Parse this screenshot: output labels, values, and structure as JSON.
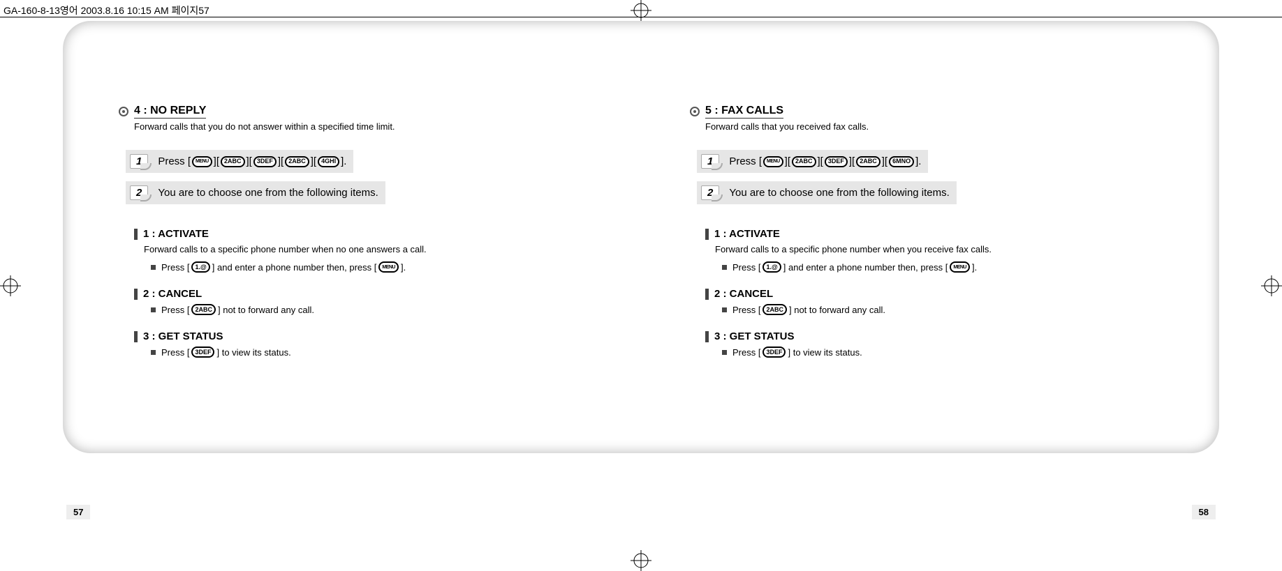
{
  "print_header": "GA-160-8-13영어  2003.8.16 10:15 AM  페이지57",
  "left": {
    "title": "4 : NO REPLY",
    "desc": "Forward calls that you do not answer within a specified time limit.",
    "step1_prefix": "Press [",
    "step1_keys": [
      "MENU",
      "2ABC",
      "3DEF",
      "2ABC",
      "4GHI"
    ],
    "step1_suffix": "].",
    "step2": "You are to choose one from the following items.",
    "sub": [
      {
        "heading": "1 : ACTIVATE",
        "desc": "Forward calls to a specific phone number when no one answers a call.",
        "action_pre": "Press [",
        "action_key1": "1.@",
        "action_mid": "] and enter a phone number then, press [",
        "action_key2": "MENU",
        "action_post": "]."
      },
      {
        "heading": "2 : CANCEL",
        "action_pre": "Press [",
        "action_key1": "2ABC",
        "action_mid": "] not to forward any call.",
        "action_key2": "",
        "action_post": ""
      },
      {
        "heading": "3 : GET STATUS",
        "action_pre": "Press [",
        "action_key1": "3DEF",
        "action_mid": "] to view its status.",
        "action_key2": "",
        "action_post": ""
      }
    ],
    "page_number": "57"
  },
  "right": {
    "title": "5 : FAX CALLS",
    "desc": "Forward calls that you received fax calls.",
    "step1_prefix": "Press [",
    "step1_keys": [
      "MENU",
      "2ABC",
      "3DEF",
      "2ABC",
      "6MNO"
    ],
    "step1_suffix": "].",
    "step2": "You are to choose one from the following items.",
    "sub": [
      {
        "heading": "1 : ACTIVATE",
        "desc": "Forward calls to a specific phone number when you receive fax calls.",
        "action_pre": "Press [",
        "action_key1": "1.@",
        "action_mid": "] and enter a phone number then, press [",
        "action_key2": "MENU",
        "action_post": "]."
      },
      {
        "heading": "2 : CANCEL",
        "action_pre": "Press [",
        "action_key1": "2ABC",
        "action_mid": "] not to forward any call.",
        "action_key2": "",
        "action_post": ""
      },
      {
        "heading": "3 : GET STATUS",
        "action_pre": "Press [",
        "action_key1": "3DEF",
        "action_mid": "] to view its status.",
        "action_key2": "",
        "action_post": ""
      }
    ],
    "page_number": "58"
  }
}
